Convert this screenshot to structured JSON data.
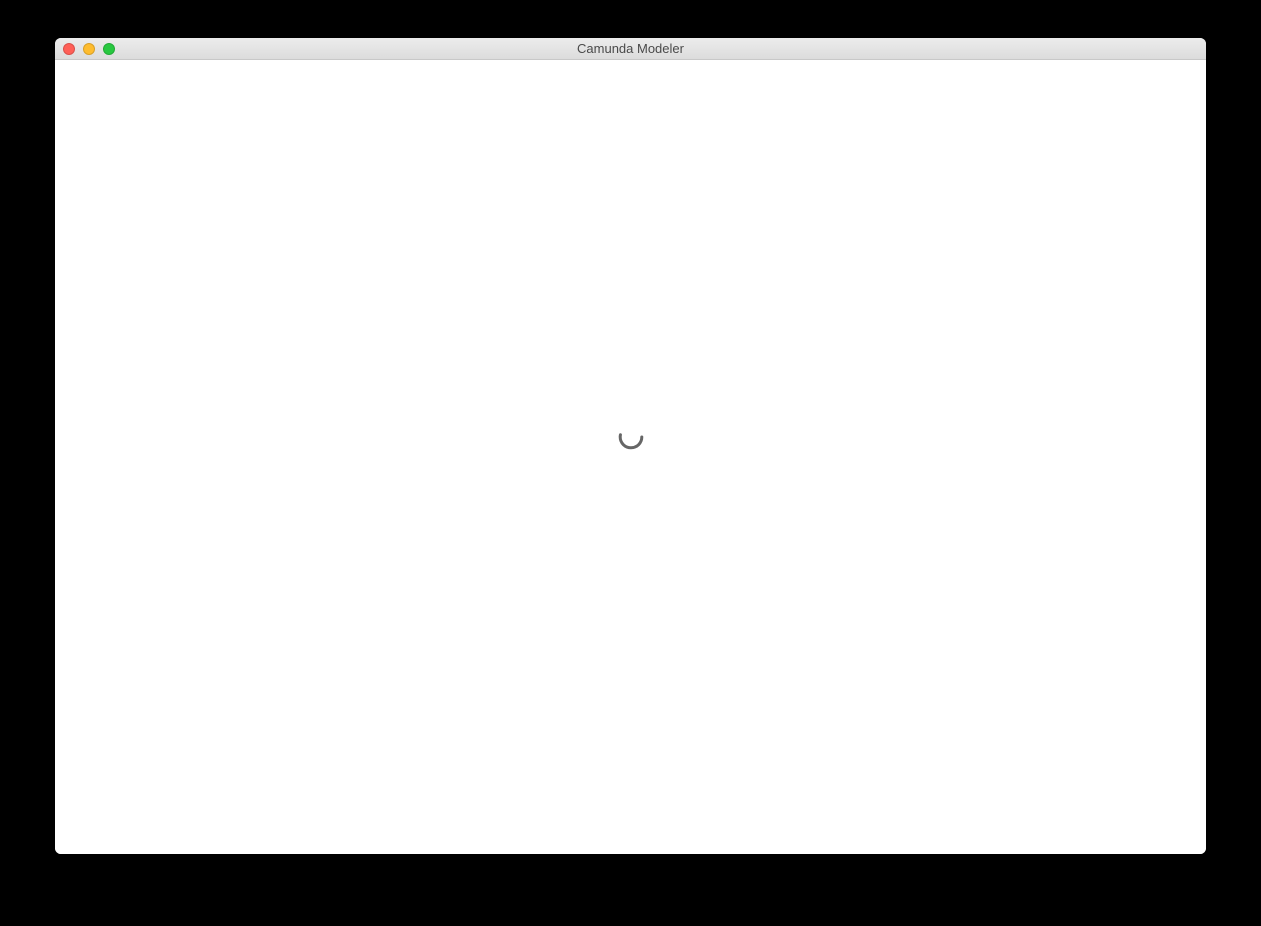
{
  "window": {
    "title": "Camunda Modeler"
  },
  "state": {
    "loading": true
  }
}
